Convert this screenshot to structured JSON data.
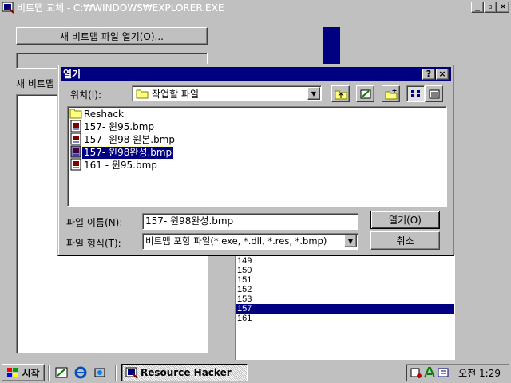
{
  "main_window": {
    "title": "비트맵 교체 - C:₩WINDOWS₩EXPLORER.EXE",
    "open_bitmap_label": "새 비트맵 파일 열기(O)...",
    "new_bitmap_label": "새 비트맵",
    "resource_ids": [
      "149",
      "150",
      "151",
      "152",
      "153",
      "157",
      "161"
    ],
    "selected_resource_id": "157"
  },
  "dialog": {
    "title": "열기",
    "location_label": "위치(I):",
    "location_value": "작업할 파일",
    "files": [
      {
        "name": "Reshack",
        "icon": "folder-icon"
      },
      {
        "name": "157- 윈95.bmp",
        "icon": "bitmap-file-icon"
      },
      {
        "name": "157- 윈98 원본.bmp",
        "icon": "bitmap-file-icon"
      },
      {
        "name": "157- 윈98완성.bmp",
        "icon": "bitmap-file-icon",
        "selected": true
      },
      {
        "name": "161 - 윈95.bmp",
        "icon": "bitmap-file-icon"
      }
    ],
    "filename_label": "파일 이름(N):",
    "filename_value": "157- 윈98완성.bmp",
    "filetype_label": "파일 형식(T):",
    "filetype_value": "비트맵 포함 파일(*.exe, *.dll, *.res, *.bmp)",
    "open_button": "열기(O)",
    "cancel_button": "취소"
  },
  "taskbar": {
    "start_label": "시작",
    "task_label": "Resource Hacker",
    "clock": "오전 1:29"
  },
  "colors": {
    "selection": "#000080",
    "face": "#c0c0c0"
  }
}
